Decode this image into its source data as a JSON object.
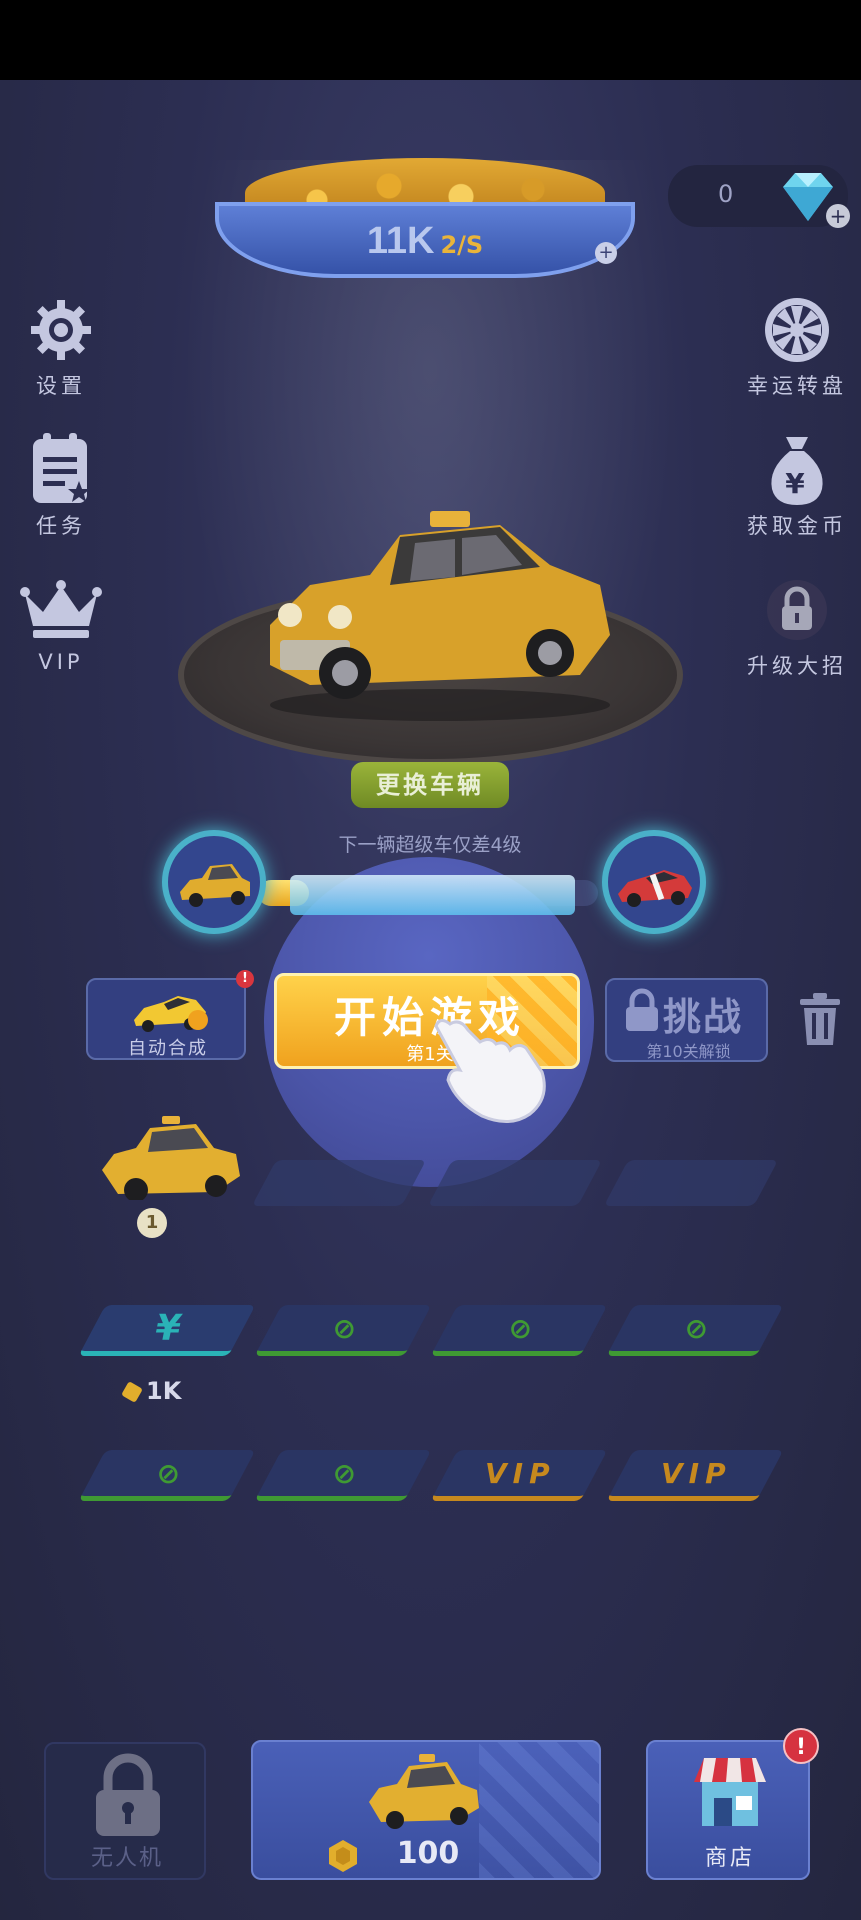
{
  "coin_bowl": {
    "amount": "11K",
    "rate": "2/S",
    "plus": "+"
  },
  "gems": {
    "count": "0",
    "plus": "+"
  },
  "left_menu": [
    {
      "id": "settings",
      "label": "设置",
      "icon": "gear-icon"
    },
    {
      "id": "tasks",
      "label": "任务",
      "icon": "clipboard-icon"
    },
    {
      "id": "vip",
      "label": "VIP",
      "icon": "crown-icon"
    }
  ],
  "right_menu": [
    {
      "id": "lucky-wheel",
      "label": "幸运转盘",
      "icon": "wheel-icon"
    },
    {
      "id": "get-coins",
      "label": "获取金币",
      "icon": "money-bag-icon"
    },
    {
      "id": "upgrade-skill",
      "label": "升级大招",
      "icon": "lock-icon"
    }
  ],
  "change_vehicle": "更换车辆",
  "progress": {
    "text": "下一辆超级车仅差4级",
    "fraction": 0.15
  },
  "auto_merge": {
    "label": "自动合成",
    "badge": "!"
  },
  "start_game": {
    "title": "开始游戏",
    "subtitle": "第1关"
  },
  "challenge": {
    "title": "挑战",
    "subtitle": "第10关解锁"
  },
  "grid": {
    "car_level": "1",
    "slot_price": "1K",
    "currency_symbol": "¥",
    "vip_label": "VIP",
    "lock_symbol": "⊘"
  },
  "bottom": {
    "drone_label": "无人机",
    "buy_price": "100",
    "shop_label": "商店",
    "shop_badge": "!"
  },
  "colors": {
    "accent_gold": "#f0a21e",
    "panel_blue": "#3a4e9e",
    "alert_red": "#d63240",
    "green_slot": "#3f9a33"
  }
}
